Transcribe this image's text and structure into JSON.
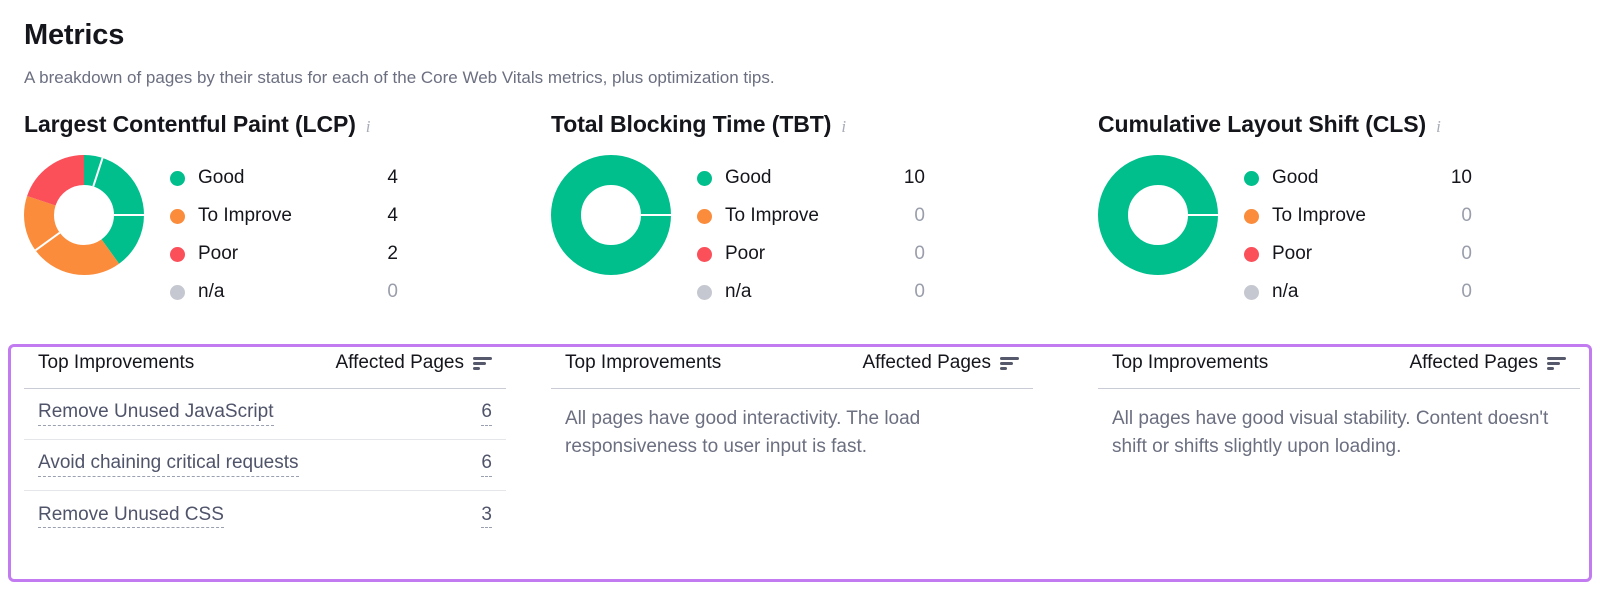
{
  "header": {
    "title": "Metrics",
    "subtitle": "A breakdown of pages by their status for each of the Core Web Vitals metrics, plus optimization tips."
  },
  "colors": {
    "good": "#00bf8c",
    "to_improve": "#fa8c3c",
    "poor": "#fb4f5a",
    "na": "#c5c8d0",
    "highlight_border": "#c27bf0",
    "text_dark": "#15161c",
    "text_muted": "#6b6f80"
  },
  "legend_labels": {
    "good": "Good",
    "to_improve": "To Improve",
    "poor": "Poor",
    "na": "n/a"
  },
  "table_headers": {
    "improvements": "Top Improvements",
    "affected_pages": "Affected Pages",
    "sort_icon": "sort-icon"
  },
  "info_icon_glyph": "i",
  "metrics": [
    {
      "id": "lcp",
      "title": "Largest Contentful Paint (LCP)",
      "legend": [
        {
          "key": "good",
          "label": "Good",
          "value": "4"
        },
        {
          "key": "to_improve",
          "label": "To Improve",
          "value": "4"
        },
        {
          "key": "poor",
          "label": "Poor",
          "value": "2"
        },
        {
          "key": "na",
          "label": "n/a",
          "value": "0"
        }
      ],
      "improvements": [
        {
          "label": "Remove Unused JavaScript",
          "count": "6"
        },
        {
          "label": "Avoid chaining critical requests",
          "count": "6"
        },
        {
          "label": "Remove Unused CSS",
          "count": "3"
        }
      ],
      "empty_message": ""
    },
    {
      "id": "tbt",
      "title": "Total Blocking Time (TBT)",
      "legend": [
        {
          "key": "good",
          "label": "Good",
          "value": "10"
        },
        {
          "key": "to_improve",
          "label": "To Improve",
          "value": "0"
        },
        {
          "key": "poor",
          "label": "Poor",
          "value": "0"
        },
        {
          "key": "na",
          "label": "n/a",
          "value": "0"
        }
      ],
      "improvements": [],
      "empty_message": "All pages have good interactivity. The load responsiveness to user input is fast."
    },
    {
      "id": "cls",
      "title": "Cumulative Layout Shift (CLS)",
      "legend": [
        {
          "key": "good",
          "label": "Good",
          "value": "10"
        },
        {
          "key": "to_improve",
          "label": "To Improve",
          "value": "0"
        },
        {
          "key": "poor",
          "label": "Poor",
          "value": "0"
        },
        {
          "key": "na",
          "label": "n/a",
          "value": "0"
        }
      ],
      "improvements": [],
      "empty_message": "All pages have good visual stability. Content doesn't shift or shifts slightly upon loading."
    }
  ],
  "chart_data": [
    {
      "type": "pie",
      "title": "Largest Contentful Paint (LCP)",
      "categories": [
        "Good",
        "To Improve",
        "Poor",
        "n/a"
      ],
      "values": [
        4,
        4,
        2,
        0
      ],
      "colors": [
        "#00bf8c",
        "#fa8c3c",
        "#fb4f5a",
        "#c5c8d0"
      ],
      "donut": true,
      "legend_position": "right"
    },
    {
      "type": "pie",
      "title": "Total Blocking Time (TBT)",
      "categories": [
        "Good",
        "To Improve",
        "Poor",
        "n/a"
      ],
      "values": [
        10,
        0,
        0,
        0
      ],
      "colors": [
        "#00bf8c",
        "#fa8c3c",
        "#fb4f5a",
        "#c5c8d0"
      ],
      "donut": true,
      "legend_position": "right"
    },
    {
      "type": "pie",
      "title": "Cumulative Layout Shift (CLS)",
      "categories": [
        "Good",
        "To Improve",
        "Poor",
        "n/a"
      ],
      "values": [
        10,
        0,
        0,
        0
      ],
      "colors": [
        "#00bf8c",
        "#fa8c3c",
        "#fb4f5a",
        "#c5c8d0"
      ],
      "donut": true,
      "legend_position": "right"
    }
  ]
}
